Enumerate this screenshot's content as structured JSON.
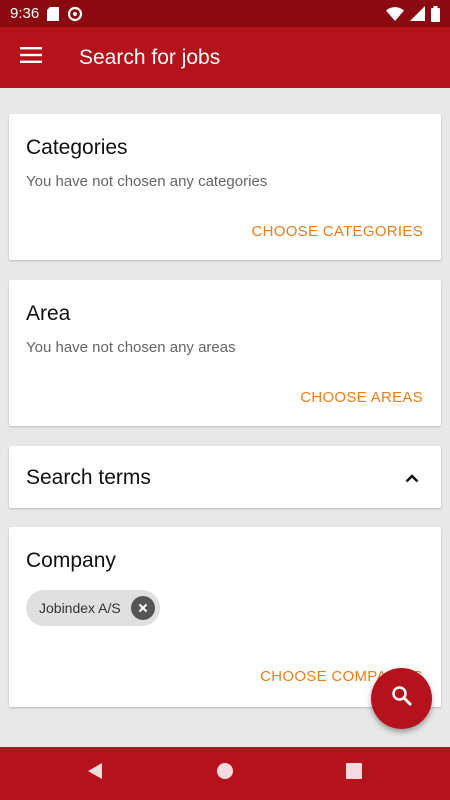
{
  "status_bar": {
    "time": "9:36",
    "icons": [
      "sd-card-icon",
      "sync-icon",
      "wifi-icon",
      "signal-icon",
      "battery-icon"
    ]
  },
  "app_bar": {
    "title": "Search for jobs",
    "menu_icon": "menu-icon"
  },
  "cards": {
    "categories": {
      "title": "Categories",
      "subtitle": "You have not chosen any categories",
      "action": "CHOOSE CATEGORIES"
    },
    "area": {
      "title": "Area",
      "subtitle": "You have not chosen any areas",
      "action": "CHOOSE AREAS"
    },
    "search_terms": {
      "title": "Search terms",
      "toggle_icon": "chevron-up-icon"
    },
    "company": {
      "title": "Company",
      "chip": "Jobindex A/S",
      "action": "CHOOSE COMPANIES"
    }
  },
  "fab": {
    "icon": "search-icon"
  },
  "nav_bar": {
    "icons": [
      "back-icon",
      "home-icon",
      "recents-icon"
    ]
  },
  "colors": {
    "primary": "#b5121b",
    "status_bar": "#8b0a10",
    "accent": "#ef7d1a",
    "background": "#e8e8e8"
  }
}
